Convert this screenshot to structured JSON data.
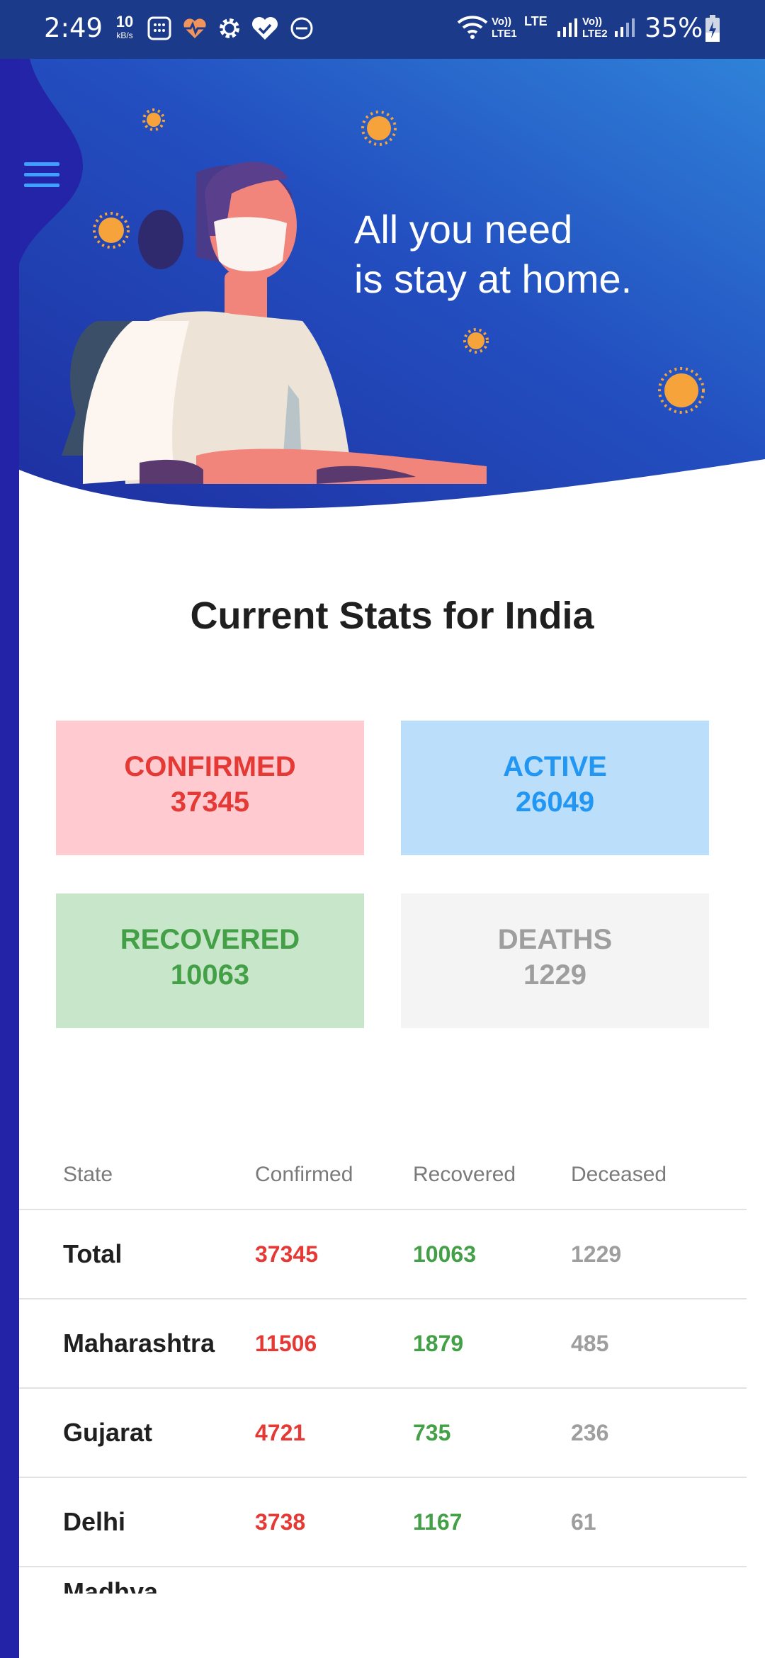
{
  "status_bar": {
    "time": "2:49",
    "net_speed_value": "10",
    "net_speed_unit": "kB/s",
    "sim1_label": "Vo)) LTE1",
    "sim2_label": "Vo)) LTE2",
    "lte_label": "LTE",
    "battery": "35%",
    "icons": [
      "calculator-icon",
      "heart-rate-icon",
      "gear-icon",
      "heart-check-icon",
      "do-not-disturb-icon",
      "wifi-icon",
      "signal-icon",
      "battery-charging-icon"
    ]
  },
  "hero": {
    "line1": "All you need",
    "line2": "is stay at home.",
    "menu_icon": "hamburger-menu-icon"
  },
  "stats": {
    "title": "Current Stats for India",
    "confirmed": {
      "label": "CONFIRMED",
      "value": "37345",
      "color": "#e53935",
      "bg": "#ffcbd1"
    },
    "active": {
      "label": "ACTIVE",
      "value": "26049",
      "color": "#2196f3",
      "bg": "#bbdefb"
    },
    "recovered": {
      "label": "RECOVERED",
      "value": "10063",
      "color": "#43a047",
      "bg": "#c8e6c9"
    },
    "deaths": {
      "label": "DEATHS",
      "value": "1229",
      "color": "#9e9e9e",
      "bg": "#f4f4f4"
    }
  },
  "table": {
    "headers": [
      "State",
      "Confirmed",
      "Recovered",
      "Deceased"
    ],
    "rows": [
      {
        "state": "Total",
        "confirmed": "37345",
        "recovered": "10063",
        "deceased": "1229"
      },
      {
        "state": "Maharashtra",
        "confirmed": "11506",
        "recovered": "1879",
        "deceased": "485"
      },
      {
        "state": "Gujarat",
        "confirmed": "4721",
        "recovered": "735",
        "deceased": "236"
      },
      {
        "state": "Delhi",
        "confirmed": "3738",
        "recovered": "1167",
        "deceased": "61"
      }
    ],
    "partial_row": "Madhya"
  }
}
